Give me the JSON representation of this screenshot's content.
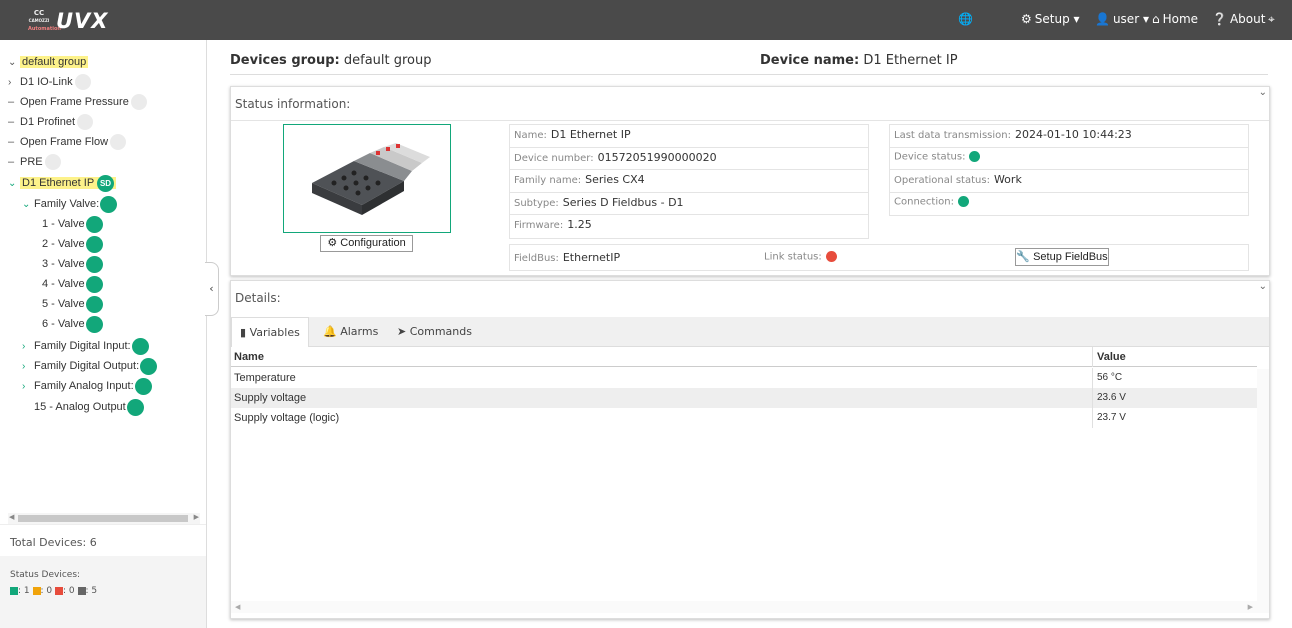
{
  "navbar": {
    "logo_top": "CC",
    "logo_sub": "CAMOZZI",
    "logo_tiny": "Automation",
    "logo_text": "UVX",
    "setup_label": "Setup",
    "user_label": "user",
    "home_label": "Home",
    "about_label": "About"
  },
  "sidebar": {
    "tree": {
      "root": "default group",
      "n1": "D1 IO-Link",
      "n2": "Open Frame Pressure",
      "n3": "D1 Profinet",
      "n4": "Open Frame Flow",
      "n5": "PRE",
      "n6": "D1 Ethernet IP",
      "n6_badge": "SD",
      "family_valve": "Family Valve:",
      "v1": "1 - Valve",
      "v2": "2 - Valve",
      "v3": "3 - Valve",
      "v4": "4 - Valve",
      "v5": "5 - Valve",
      "v6": "6 - Valve",
      "fdi": "Family Digital Input:",
      "fdo": "Family Digital Output:",
      "fai": "Family Analog Input:",
      "ao": "15 - Analog Output"
    },
    "total_devices": "Total Devices: 6",
    "status_title": "Status Devices:",
    "status_counts": {
      "green": ": 1",
      "orange": ": 0",
      "red": ": 0",
      "gray": ": 5"
    },
    "colors": {
      "green": "#12a77a",
      "orange": "#f0a30a",
      "red": "#e74c3c",
      "gray": "#666666"
    }
  },
  "header": {
    "group_label": "Devices group:",
    "group_value": "default group",
    "device_label": "Device name:",
    "device_value": "D1 Ethernet IP"
  },
  "status_panel": {
    "title": "Status information:",
    "config_button": "Configuration",
    "name_label": "Name:",
    "name_value": "D1 Ethernet IP",
    "number_label": "Device number:",
    "number_value": "01572051990000020",
    "family_label": "Family name:",
    "family_value": "Series CX4",
    "subtype_label": "Subtype:",
    "subtype_value": "Series D Fieldbus - D1",
    "firmware_label": "Firmware:",
    "firmware_value": "1.25",
    "last_tx_label": "Last data transmission:",
    "last_tx_value": "2024-01-10 10:44:23",
    "device_status_label": "Device status:",
    "op_status_label": "Operational status:",
    "op_status_value": "Work",
    "connection_label": "Connection:",
    "fieldbus_label": "FieldBus:",
    "fieldbus_value": "EthernetIP",
    "link_status_label": "Link status:",
    "setup_fieldbus_button": "Setup FieldBus"
  },
  "details_panel": {
    "title": "Details:",
    "tabs": [
      "Variables",
      "Alarms",
      "Commands"
    ],
    "columns": [
      "Name",
      "Value"
    ],
    "rows": [
      {
        "name": "Temperature",
        "value": "56 °C"
      },
      {
        "name": "Supply voltage",
        "value": "23.6 V"
      },
      {
        "name": "Supply voltage (logic)",
        "value": "23.7 V"
      }
    ]
  }
}
